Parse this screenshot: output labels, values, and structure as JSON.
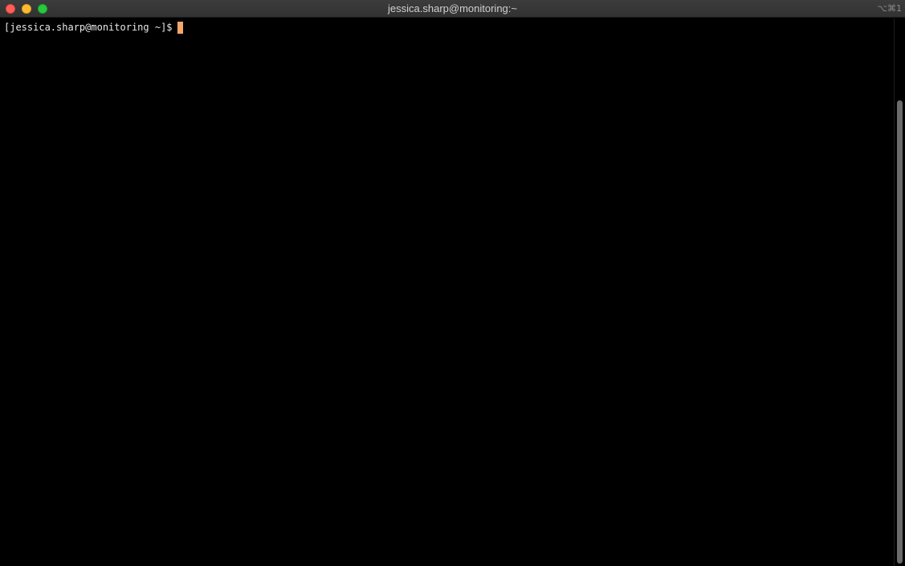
{
  "window": {
    "title": "jessica.sharp@monitoring:~",
    "shortcut": "⌥⌘1"
  },
  "terminal": {
    "prompt": "[jessica.sharp@monitoring ~]$",
    "input": ""
  },
  "colors": {
    "background": "#000000",
    "text": "#e8e8e8",
    "cursor": "#f3a76a",
    "close": "#ff5f57",
    "minimize": "#febc2e",
    "zoom": "#28c840"
  },
  "icons": {
    "close": "close-icon",
    "minimize": "minimize-icon",
    "zoom": "zoom-icon"
  }
}
